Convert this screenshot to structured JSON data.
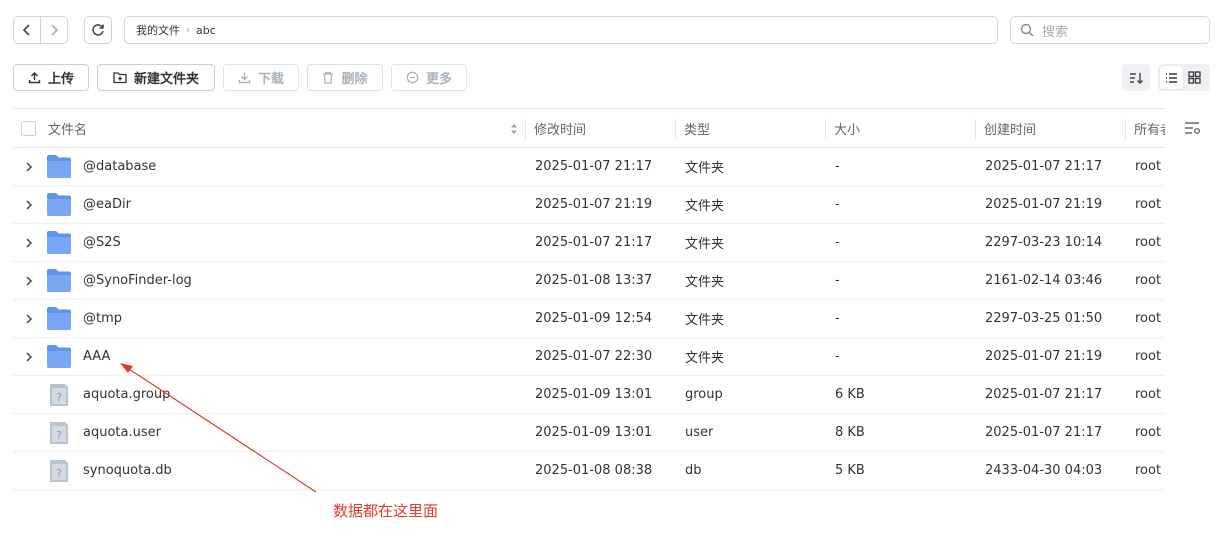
{
  "nav": {
    "back_icon": "chevron-left-icon",
    "forward_icon": "chevron-right-icon",
    "refresh_icon": "refresh-icon"
  },
  "path": {
    "root": "我的文件",
    "current": "abc"
  },
  "search": {
    "placeholder": "搜索"
  },
  "toolbar": {
    "upload": "上传",
    "new_folder": "新建文件夹",
    "download": "下载",
    "delete": "删除",
    "more": "更多"
  },
  "columns": {
    "name": "文件名",
    "modified": "修改时间",
    "type": "类型",
    "size": "大小",
    "created": "创建时间",
    "owner": "所有者"
  },
  "rows": [
    {
      "name": "@database",
      "modified": "2025-01-07 21:17",
      "type": "文件夹",
      "size": "-",
      "created": "2025-01-07 21:17",
      "owner": "root",
      "kind": "folder"
    },
    {
      "name": "@eaDir",
      "modified": "2025-01-07 21:19",
      "type": "文件夹",
      "size": "-",
      "created": "2025-01-07 21:19",
      "owner": "root",
      "kind": "folder"
    },
    {
      "name": "@S2S",
      "modified": "2025-01-07 21:17",
      "type": "文件夹",
      "size": "-",
      "created": "2297-03-23 10:14",
      "owner": "root",
      "kind": "folder"
    },
    {
      "name": "@SynoFinder-log",
      "modified": "2025-01-08 13:37",
      "type": "文件夹",
      "size": "-",
      "created": "2161-02-14 03:46",
      "owner": "root",
      "kind": "folder"
    },
    {
      "name": "@tmp",
      "modified": "2025-01-09 12:54",
      "type": "文件夹",
      "size": "-",
      "created": "2297-03-25 01:50",
      "owner": "root",
      "kind": "folder"
    },
    {
      "name": "AAA",
      "modified": "2025-01-07 22:30",
      "type": "文件夹",
      "size": "-",
      "created": "2025-01-07 21:19",
      "owner": "root",
      "kind": "folder"
    },
    {
      "name": "aquota.group",
      "modified": "2025-01-09 13:01",
      "type": "group",
      "size": "6 KB",
      "created": "2025-01-07 21:17",
      "owner": "root",
      "kind": "file"
    },
    {
      "name": "aquota.user",
      "modified": "2025-01-09 13:01",
      "type": "user",
      "size": "8 KB",
      "created": "2025-01-07 21:17",
      "owner": "root",
      "kind": "file"
    },
    {
      "name": "synoquota.db",
      "modified": "2025-01-08 08:38",
      "type": "db",
      "size": "5 KB",
      "created": "2433-04-30 04:03",
      "owner": "root",
      "kind": "file"
    }
  ],
  "annotation": {
    "text": "数据都在这里面",
    "color": "#e03a2b"
  },
  "colors": {
    "folder": "#7aa7f5",
    "folder_dark": "#5f93ee",
    "file": "#b9c3cf"
  }
}
